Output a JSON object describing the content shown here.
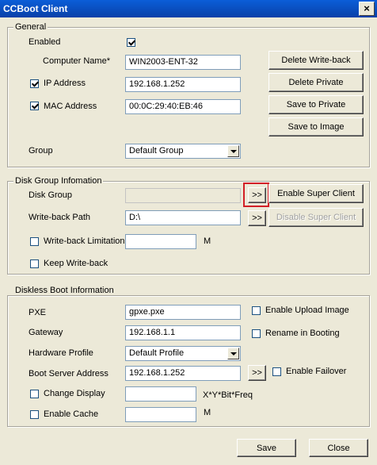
{
  "window": {
    "title": "CCBoot Client"
  },
  "general": {
    "legend": "General",
    "enabled_label": "Enabled",
    "enabled_checked": true,
    "computer_name_label": "Computer Name*",
    "computer_name_value": "WIN2003-ENT-32",
    "ip_label": "IP Address",
    "ip_checked": true,
    "ip_value": "192.168.1.252",
    "mac_label": "MAC Address",
    "mac_checked": true,
    "mac_value": "00:0C:29:40:EB:46",
    "group_label": "Group",
    "group_value": "Default Group",
    "buttons": {
      "delete_writeback": "Delete Write-back",
      "delete_private": "Delete Private",
      "save_private": "Save to Private",
      "save_image": "Save to Image"
    }
  },
  "disk": {
    "legend": "Disk Group Infomation",
    "disk_group_label": "Disk Group",
    "disk_group_value": "",
    "browse": ">>",
    "enable_super_client": "Enable Super Client",
    "writeback_path_label": "Write-back Path",
    "writeback_path_value": "D:\\",
    "disable_super_client": "Disable Super Client",
    "writeback_limit_label": "Write-back Limitation",
    "writeback_limit_value": "",
    "writeback_limit_unit": "M",
    "keep_writeback_label": "Keep Write-back"
  },
  "diskless": {
    "legend": "Diskless Boot Information",
    "pxe_label": "PXE",
    "pxe_value": "gpxe.pxe",
    "enable_upload_label": "Enable Upload Image",
    "gateway_label": "Gateway",
    "gateway_value": "192.168.1.1",
    "rename_label": "Rename in Booting",
    "hw_profile_label": "Hardware Profile",
    "hw_profile_value": "Default Profile",
    "boot_server_label": "Boot Server Address",
    "boot_server_value": "192.168.1.252",
    "enable_failover_label": "Enable Failover",
    "change_display_label": "Change Display",
    "change_display_value": "",
    "change_display_hint": "X*Y*Bit*Freq",
    "enable_cache_label": "Enable Cache",
    "enable_cache_value": "",
    "enable_cache_unit": "M"
  },
  "footer": {
    "save": "Save",
    "close": "Close"
  }
}
